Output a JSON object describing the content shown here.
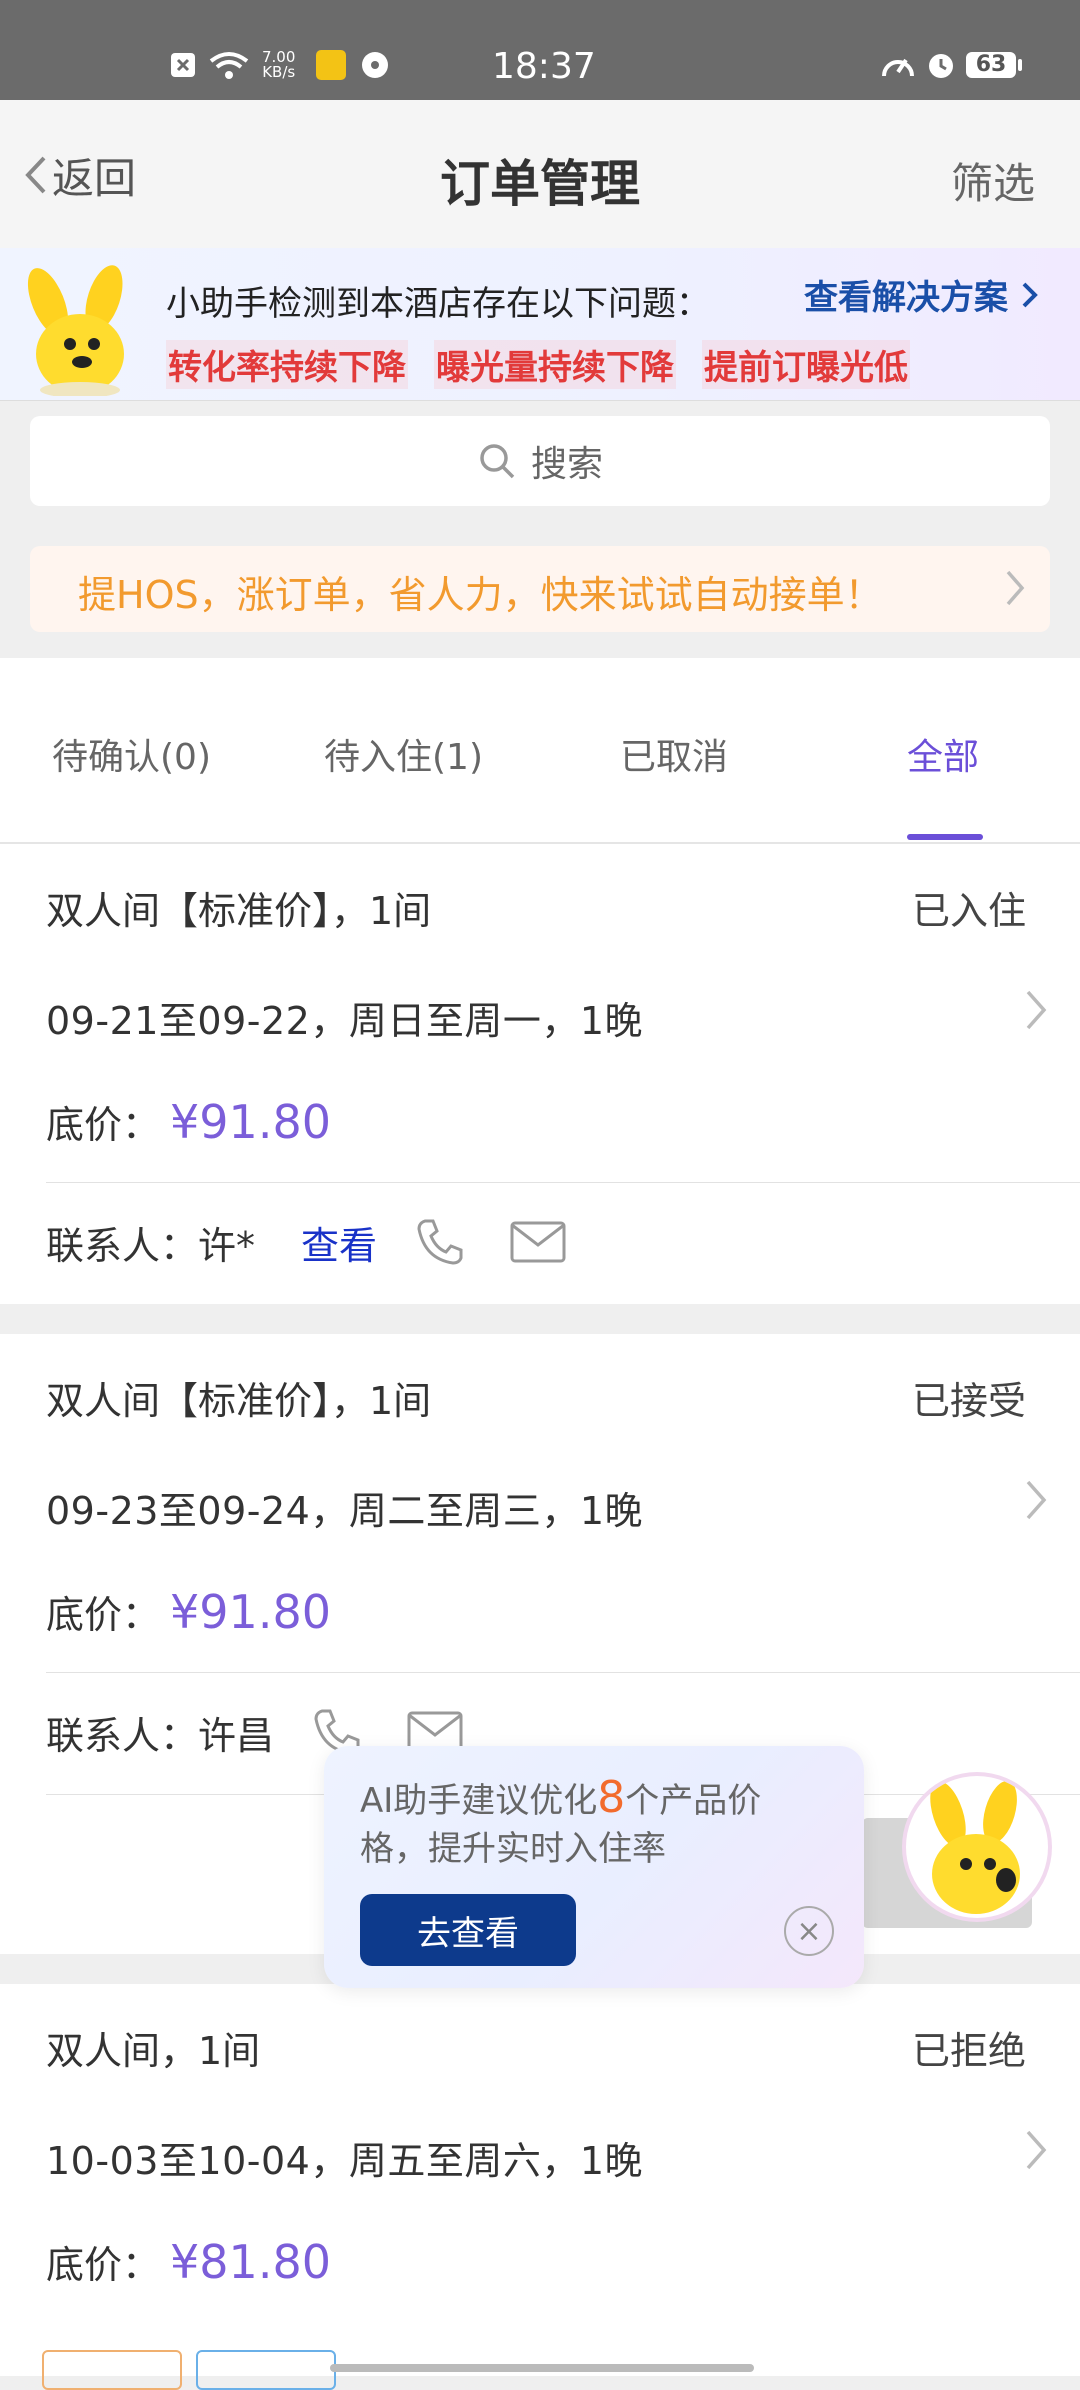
{
  "status_bar": {
    "time": "18:37",
    "net_speed_value": "7.00",
    "net_speed_unit": "KB/s",
    "battery": "63"
  },
  "nav": {
    "back_label": "返回",
    "title": "订单管理",
    "filter_label": "筛选"
  },
  "alert": {
    "message": "小助手检测到本酒店存在以下问题：",
    "link_label": "查看解决方案",
    "issues": [
      "转化率持续下降",
      "曝光量持续下降",
      "提前订曝光低"
    ]
  },
  "search": {
    "placeholder": "搜索"
  },
  "promo": {
    "text": "提HOS，涨订单，省人力，快来试试自动接单！"
  },
  "tabs": [
    {
      "label": "待确认(0)",
      "active": false
    },
    {
      "label": "待入住(1)",
      "active": false
    },
    {
      "label": "已取消",
      "active": false
    },
    {
      "label": "全部",
      "active": true
    }
  ],
  "orders": [
    {
      "room": "双人间【标准价】，1间",
      "status": "已入住",
      "dates": "09-21至09-22，周日至周一，1晚",
      "price_label": "底价：",
      "price": "¥91.80",
      "contact_label": "联系人：",
      "contact_name": "许*",
      "view_label": "查看"
    },
    {
      "room": "双人间【标准价】，1间",
      "status": "已接受",
      "dates": "09-23至09-24，周二至周三，1晚",
      "price_label": "底价：",
      "price": "¥91.80",
      "contact_label": "联系人：",
      "contact_name": "许昌"
    },
    {
      "room": "双人间，1间",
      "status": "已拒绝",
      "dates": "10-03至10-04，周五至周六，1晚",
      "price_label": "底价：",
      "price": "¥81.80"
    }
  ],
  "ai_popup": {
    "text_before": "AI助手建议优化",
    "count": "8",
    "text_after": "个产品价格，提升实时入住率",
    "button_label": "去查看"
  },
  "colors": {
    "accent": "#6b4fd8",
    "price": "#7b5ed9",
    "alert_red": "#e23a3a",
    "promo_orange": "#f29a2e",
    "link_blue": "#1a4fa8",
    "button_navy": "#0d3a8c"
  }
}
